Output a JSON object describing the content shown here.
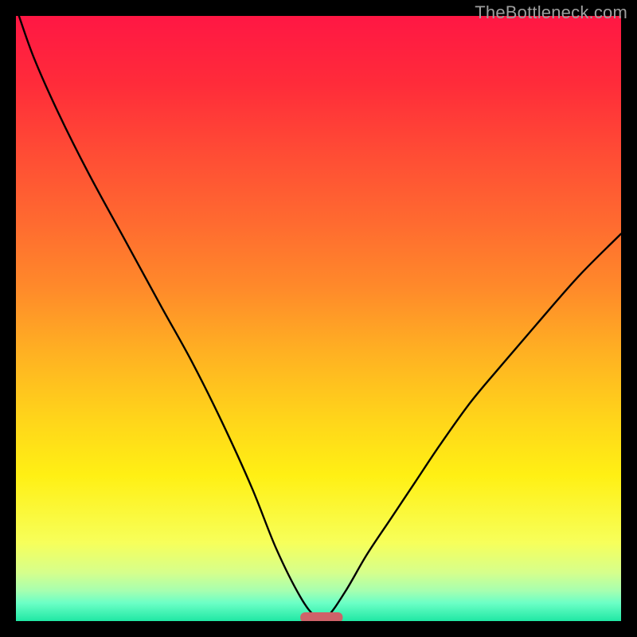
{
  "attribution": {
    "watermark": "TheBottleneck.com"
  },
  "chart_data": {
    "type": "line",
    "title": "",
    "xlabel": "",
    "ylabel": "",
    "xlim": [
      0,
      100
    ],
    "ylim": [
      0,
      100
    ],
    "gradient_stops": [
      {
        "y": 0,
        "color": "#ff1744"
      },
      {
        "y": 11,
        "color": "#ff2b3a"
      },
      {
        "y": 22,
        "color": "#ff4a35"
      },
      {
        "y": 34,
        "color": "#ff6a30"
      },
      {
        "y": 45,
        "color": "#ff8a2a"
      },
      {
        "y": 56,
        "color": "#ffb222"
      },
      {
        "y": 67,
        "color": "#ffd61a"
      },
      {
        "y": 76,
        "color": "#fff014"
      },
      {
        "y": 87,
        "color": "#f7ff5a"
      },
      {
        "y": 92,
        "color": "#d6ff8c"
      },
      {
        "y": 95,
        "color": "#a6ffb0"
      },
      {
        "y": 97,
        "color": "#6cffc6"
      },
      {
        "y": 100,
        "color": "#20e8a4"
      }
    ],
    "series": [
      {
        "name": "bottleneck-curve",
        "x": [
          0.5,
          3,
          7,
          12,
          18,
          24,
          29,
          34,
          39,
          43,
          47,
          49.5,
          51.5,
          54.5,
          58,
          62,
          66,
          70,
          75,
          80,
          86,
          93,
          100
        ],
        "y": [
          100,
          93,
          84,
          74,
          63,
          52,
          43,
          33,
          22,
          12,
          4,
          0.8,
          0.8,
          5,
          11,
          17,
          23,
          29,
          36,
          42,
          49,
          57,
          64
        ]
      }
    ],
    "marker": {
      "name": "bottleneck-min-marker",
      "color": "#ce6269",
      "x_range": [
        47,
        54
      ],
      "y": 0.6,
      "thickness": 1.7
    }
  }
}
